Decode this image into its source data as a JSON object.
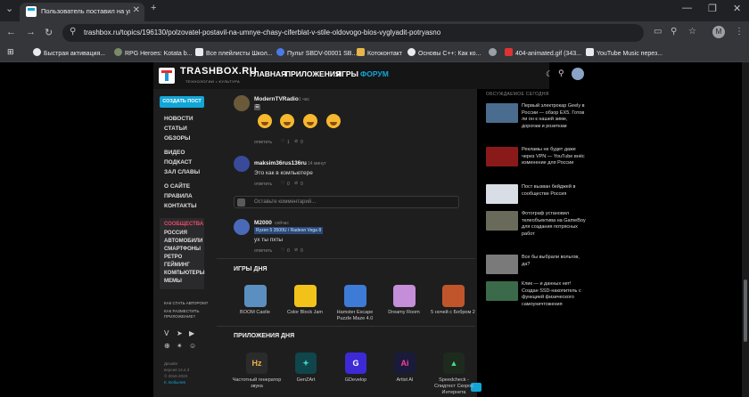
{
  "browser": {
    "tab_title": "Пользователь поставил на умн...",
    "url": "trashbox.ru/topics/196130/polzovatel-postavil-na-umnye-chasy-ciferblat-v-stile-oldovogo-bios-vyglyadit-potryasno",
    "profile_initial": "M",
    "bookmarks": [
      "Быстрая активация...",
      "RPG Heroes: Kotata b...",
      "Все плейлисты Школ...",
      "Пульт SBDV-00001 SB...",
      "Котоконтакт",
      "Основы C++: Как ко...",
      "",
      "404-animated.gif (343...",
      "YouTube Music перез..."
    ]
  },
  "site": {
    "logo": "TRASHBOX.RU",
    "logo_sub": "ТЕХНОЛОГИИ • КУЛЬТУРА",
    "nav": [
      "ГЛАВНАЯ",
      "ПРИЛОЖЕНИЯ",
      "ИГРЫ",
      "ФОРУМ"
    ],
    "create_post": "СОЗДАТЬ ПОСТ",
    "left_nav_1": [
      "НОВОСТИ",
      "СТАТЬИ",
      "ОБЗОРЫ"
    ],
    "left_nav_2": [
      "ВИДЕО",
      "ПОДКАСТ",
      "ЗАЛ СЛАВЫ"
    ],
    "left_nav_3": [
      "О САЙТЕ",
      "ПРАВИЛА",
      "КОНТАКТЫ"
    ],
    "communities_title": "СООБЩЕСТВА",
    "communities": [
      "РОССИЯ",
      "АВТОМОБИЛИ",
      "СМАРТФОНЫ",
      "РЕТРО",
      "ГЕЙМИНГ",
      "КОМПЬЮТЕРЫ",
      "МЕМЫ"
    ],
    "author_link": "КАК СТАТЬ АВТОРОМ?",
    "placement_link_1": "КАК РАЗМЕСТИТЬ",
    "placement_link_2": "ПРИЛОЖЕНИЕ?",
    "footer": [
      "Дизайн",
      "версия 14.4.3",
      "© 2016-2023",
      "К. Бобылев"
    ]
  },
  "comments": [
    {
      "name": "ModernTVRadio",
      "time": "1 час",
      "reply": "ответить",
      "likes": "1",
      "dislikes": "0"
    },
    {
      "name": "maksim36rus136ru",
      "time": "14 минут",
      "text": "Это как в компьютере",
      "reply": "ответить",
      "likes": "0",
      "dislikes": "0"
    },
    {
      "name": "M2000",
      "time": "сейчас",
      "mention": "Ryzen 5 3500U / Radeon Vega 8",
      "text": "ух ты пхты",
      "reply": "ответить",
      "likes": "0",
      "dislikes": "0"
    }
  ],
  "reply_placeholder": "Оставьте комментарий...",
  "games_title": "ИГРЫ ДНЯ",
  "games": [
    {
      "label": "BOOM Castle",
      "color": "#5b8fbf"
    },
    {
      "label": "Color Block Jam",
      "color": "#f2c21b"
    },
    {
      "label": "Hamster Escape Puzzle Maze 4.0",
      "color": "#3d7bd6"
    },
    {
      "label": "Dreamy Room",
      "color": "#c48ed8"
    },
    {
      "label": "5 ночей с Бобром 2",
      "color": "#c0552b"
    }
  ],
  "apps_title": "ПРИЛОЖЕНИЯ ДНЯ",
  "apps": [
    {
      "label": "Частотный генератор звука",
      "icon": "Hz",
      "bg": "#2b2b2b",
      "fg": "#e8b54a"
    },
    {
      "label": "GenZArt",
      "icon": "✦",
      "bg": "#10454c",
      "fg": "#3fd1c2"
    },
    {
      "label": "GDevelop",
      "icon": "G",
      "bg": "#3d2ad6",
      "fg": "#ffffff"
    },
    {
      "label": "Artist AI",
      "icon": "Ai",
      "bg": "#1a1a3a",
      "fg": "#ff3e9a"
    },
    {
      "label": "Speedcheck - Спидтест Скорос Интернета",
      "icon": "▲",
      "bg": "#1e2a1e",
      "fg": "#3ddc84"
    }
  ],
  "right": {
    "title": "ОБСУЖДАЕМОЕ СЕГОДНЯ",
    "items": [
      {
        "text": "Первый электрокар Geely в России — обзор EX5. Готов ли он к нашей зиме, дорогам и розеткам",
        "color": "#4a6d8f"
      },
      {
        "text": "Рекламы не будет даже через VPN — YouTube внёс изменение для России",
        "color": "#8a1a1a"
      },
      {
        "text": "Пост вызван бейджей в сообществе Россия",
        "color": "#d9dde6"
      },
      {
        "text": "Фотограф установил телеобъектива на GameBoy для создания потрясных работ",
        "color": "#6a6a5a"
      },
      {
        "text": "Все бы выбрали вольгов, да?",
        "color": "#7a7a7a"
      },
      {
        "text": "Клик — и данных нет! Создан SSD-накопитель с функцией физического самоуничтожения",
        "color": "#3a6a4a"
      }
    ]
  }
}
